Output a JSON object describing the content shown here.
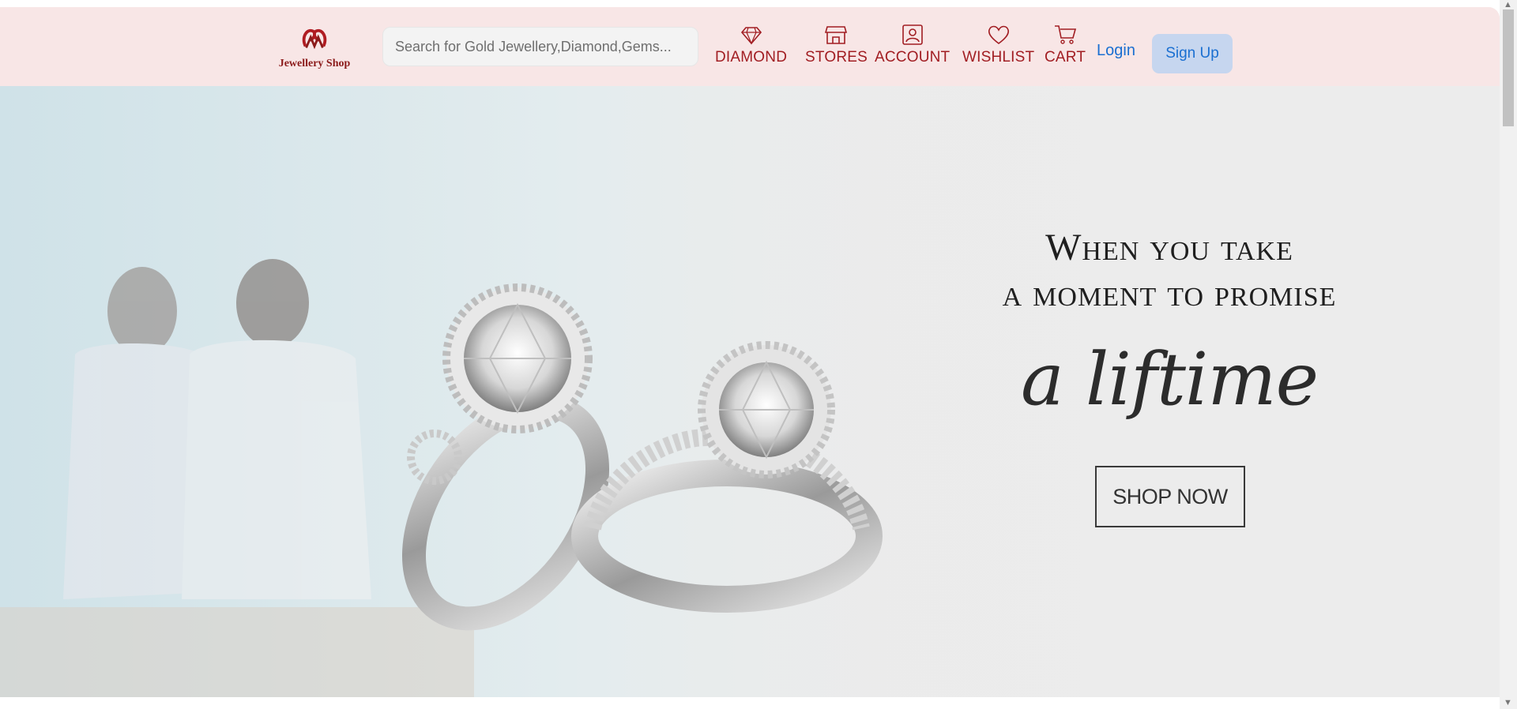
{
  "brand": {
    "name": "Jewellery Shop"
  },
  "search": {
    "placeholder": "Search for Gold Jewellery,Diamond,Gems..."
  },
  "nav": {
    "items": [
      {
        "label": "DIAMOND",
        "icon": "diamond-icon"
      },
      {
        "label": "STORES",
        "icon": "store-icon"
      },
      {
        "label": "ACCOUNT",
        "icon": "account-icon"
      },
      {
        "label": "WISHLIST",
        "icon": "heart-icon"
      },
      {
        "label": "CART",
        "icon": "cart-icon"
      }
    ],
    "login_label": "Login",
    "signup_label": "Sign Up"
  },
  "hero": {
    "line1": "When you take",
    "line2": "a moment to promise",
    "script": "a liftime",
    "cta": "SHOP NOW"
  },
  "colors": {
    "header_bg": "#f8e6e6",
    "nav_text": "#a11d22",
    "link_blue": "#1a6fd1",
    "signup_bg": "#c6d6ef"
  }
}
